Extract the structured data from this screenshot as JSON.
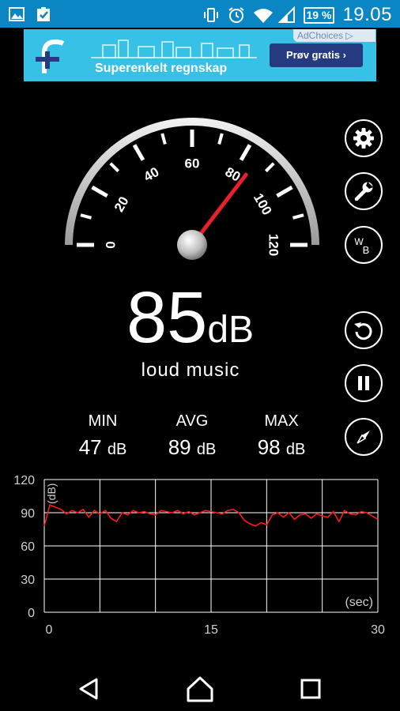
{
  "status_bar": {
    "battery": "19 %",
    "time": "19.05"
  },
  "ad": {
    "headline": "Superenkelt regnskap",
    "cta": "Prøv gratis",
    "choices": "AdChoices"
  },
  "gauge": {
    "ticks": [
      "0",
      "20",
      "40",
      "60",
      "80",
      "100",
      "120"
    ],
    "needle_value": 85
  },
  "reading": {
    "value": "85",
    "unit": "dB",
    "description": "loud music"
  },
  "stats": {
    "min_label": "MIN",
    "min_value": "47",
    "min_unit": "dB",
    "avg_label": "AVG",
    "avg_value": "89",
    "avg_unit": "dB",
    "max_label": "MAX",
    "max_value": "98",
    "max_unit": "dB"
  },
  "side_buttons": [
    "gear-icon",
    "wrench-icon",
    "weighting-icon",
    "reset-icon",
    "pause-icon",
    "compass-icon"
  ],
  "weighting_label": {
    "top": "W",
    "bottom": "B"
  },
  "chart_data": {
    "type": "line",
    "ylabel": "(dB)",
    "xlabel": "(sec)",
    "ylim": [
      0,
      120
    ],
    "xlim": [
      0,
      30
    ],
    "y_ticks": [
      "120",
      "90",
      "60",
      "30",
      "0"
    ],
    "x_ticks": [
      "0",
      "15",
      "30"
    ],
    "grid": true,
    "series": [
      {
        "color": "#ff1a1a",
        "x": [
          0,
          0.5,
          1,
          1.5,
          2,
          2.5,
          3,
          3.5,
          4,
          4.5,
          5,
          5.5,
          6,
          6.5,
          7,
          7.5,
          8,
          8.5,
          9,
          9.5,
          10,
          10.5,
          11,
          11.5,
          12,
          12.5,
          13,
          13.5,
          14,
          14.5,
          15,
          15.5,
          16,
          16.5,
          17,
          17.5,
          18,
          18.5,
          19,
          19.5,
          20,
          20.5,
          21,
          21.5,
          22,
          22.5,
          23,
          23.5,
          24,
          24.5,
          25,
          25.5,
          26,
          26.5,
          27,
          27.5,
          28,
          28.5,
          29,
          29.5,
          30
        ],
        "values": [
          78,
          97,
          95,
          93,
          89,
          92,
          90,
          93,
          86,
          92,
          89,
          92,
          85,
          82,
          90,
          88,
          92,
          90,
          91,
          89,
          88,
          92,
          91,
          90,
          92,
          89,
          91,
          88,
          90,
          92,
          91,
          90,
          89,
          92,
          93,
          90,
          83,
          80,
          78,
          81,
          79,
          88,
          90,
          86,
          90,
          84,
          88,
          89,
          85,
          89,
          87,
          86,
          91,
          82,
          92,
          89,
          88,
          91,
          90,
          87,
          84
        ]
      }
    ]
  },
  "colors": {
    "status_bar": "#0a86c4",
    "ad_background": "#38c1e6",
    "ad_button": "#263a82",
    "needle": "#e8202a",
    "line": "#ff1a1a"
  }
}
